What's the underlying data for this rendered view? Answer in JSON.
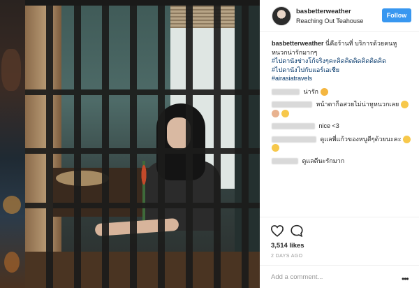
{
  "post": {
    "username": "basbetterweather",
    "location": "Reaching Out Teahouse",
    "follow_label": "Follow",
    "caption_user": "basbetterweather",
    "caption_text": "นี่คือร้านที่ บริการด้วยคนหูหนวกน่ารักมากๆ",
    "hashtags": [
      "#ไปดานังช่างโก้จริงๆคะคิดคิดคิดคิดคิดคิด",
      "#ไปดานังไปกับแอร์เอเชีย",
      "#airasiatravels"
    ]
  },
  "comments": [
    {
      "text": "น่ารัก",
      "emoji": "heart-eyes"
    },
    {
      "text": "หน้าตาก็อสวยไม่น่าหูหนวกเลย",
      "emoji": "wink"
    },
    {
      "text": "nice <3",
      "emoji": ""
    },
    {
      "text": "ดูแลพี่แก้วของหนูดีๆด้วยนะคะ",
      "emoji": "wink"
    },
    {
      "text": "ดูแลดีนะรักมาก",
      "emoji": ""
    }
  ],
  "actions": {
    "likes": "3,514 likes",
    "time": "2 DAYS AGO",
    "comment_placeholder": "Add a comment...",
    "more": "•••"
  },
  "colors": {
    "accent": "#3897f0",
    "hashtag": "#003569"
  }
}
